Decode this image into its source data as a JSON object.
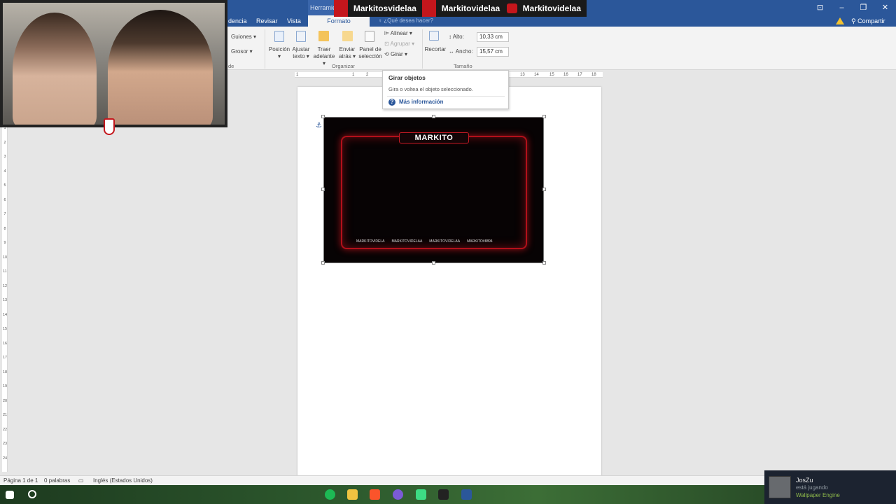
{
  "titlebar": {
    "context_tab_label": "Herramientas",
    "window_buttons": [
      "⊡",
      "–",
      "❐",
      "✕"
    ]
  },
  "stream_banner": {
    "items": [
      {
        "icon": "twitter-icon",
        "text": "Markitosvidelaa"
      },
      {
        "icon": "instagram-icon",
        "text": "Markitovidelaa"
      },
      {
        "icon": "youtube-icon",
        "text": "Markitovidelaa"
      }
    ]
  },
  "tabs": {
    "items": [
      "dencia",
      "Revisar",
      "Vista",
      "Formato"
    ],
    "active": "Formato",
    "tellme_placeholder": "¿Qué desea hacer?",
    "share_label": "Compartir"
  },
  "ribbon": {
    "guiones": "Guiones",
    "grosor": "Grosor",
    "group_left_label": "de",
    "posicion": "Posición",
    "ajustar_l1": "Ajustar",
    "ajustar_l2": "texto",
    "traer_l1": "Traer",
    "traer_l2": "adelante",
    "enviar_l1": "Enviar",
    "enviar_l2": "atrás",
    "panel_l1": "Panel de",
    "panel_l2": "selección",
    "alinear": "Alinear",
    "agrupar": "Agrupar",
    "girar": "Girar",
    "organizar_label": "Organizar",
    "recortar": "Recortar",
    "alto_label": "Alto:",
    "alto_value": "10,33 cm",
    "ancho_label": "Ancho:",
    "ancho_value": "15,57 cm",
    "tamano_label": "Tamaño"
  },
  "tooltip": {
    "title": "Girar objetos",
    "description": "Gira o voltea el objeto seleccionado.",
    "link": "Más información"
  },
  "ruler": {
    "h_ticks": [
      "1",
      "1",
      "2",
      "13",
      "14",
      "15",
      "16",
      "17",
      "18"
    ],
    "v_ticks": [
      "1",
      "2",
      "3",
      "4",
      "5",
      "6",
      "7",
      "8",
      "9",
      "10",
      "11",
      "12",
      "13",
      "14",
      "15",
      "16",
      "17",
      "18",
      "19",
      "20",
      "21",
      "22",
      "23",
      "24"
    ]
  },
  "image": {
    "title": "MARKITO",
    "socials": [
      "MARKITOVIDELA",
      "MARKITOVIDELAA",
      "MARKITOVIDELAA",
      "MARKITO#8894"
    ]
  },
  "statusbar": {
    "page": "Página 1 de 1",
    "words": "0 palabras",
    "language": "Inglés (Estados Unidos)"
  },
  "notification": {
    "name": "JosZu",
    "status": "está jugando",
    "game": "Wallpaper Engine"
  },
  "colors": {
    "word_blue": "#2b579a",
    "frame_red": "#b3101a",
    "steam_green": "#8fba4b"
  }
}
